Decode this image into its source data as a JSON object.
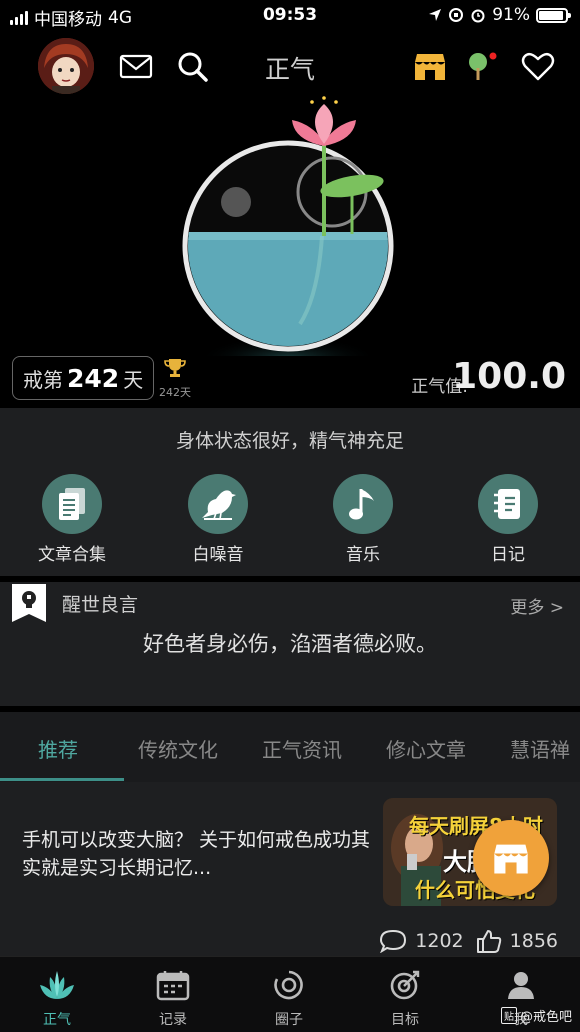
{
  "status_bar": {
    "carrier": "中国移动",
    "network": "4G",
    "time": "09:53",
    "battery": "91%",
    "battery_level": 0.91
  },
  "top_nav": {
    "title": "正气",
    "icons": [
      "mail-icon",
      "search-icon",
      "store-icon",
      "tree-icon",
      "heart-icon"
    ]
  },
  "hero": {
    "day_prefix": "戒第",
    "day_count": "242",
    "day_suffix": "天",
    "trophy_label": "242天",
    "qi_label": "正气值:",
    "qi_value": "100.0"
  },
  "panel": {
    "status_text": "身体状态很好，精气神充足",
    "features": [
      {
        "label": "文章合集",
        "icon": "documents-icon"
      },
      {
        "label": "白噪音",
        "icon": "bird-icon"
      },
      {
        "label": "音乐",
        "icon": "music-note-icon"
      },
      {
        "label": "日记",
        "icon": "diary-icon"
      }
    ]
  },
  "quote": {
    "title": "醒世良言",
    "more": "更多 >",
    "text": "好色者身必伤，淊酒者德必败。"
  },
  "tabs": [
    "推荐",
    "传统文化",
    "正气资讯",
    "修心文章",
    "慧语禅"
  ],
  "article": {
    "title": "手机可以改变大脑？ 关于如何戒色成功其实就是实习长期记忆...",
    "thumb_lines": [
      "每天刷屏8小时",
      "大脑",
      "什么可怕变化"
    ],
    "comments": "1202",
    "likes": "1856"
  },
  "bottom_nav": [
    {
      "label": "正气",
      "icon": "lotus-icon"
    },
    {
      "label": "记录",
      "icon": "calendar-icon"
    },
    {
      "label": "圈子",
      "icon": "circle-icon"
    },
    {
      "label": "目标",
      "icon": "target-icon"
    },
    {
      "label": "我",
      "icon": "user-icon"
    }
  ],
  "watermark": {
    "box": "贴",
    "text": "@戒色吧"
  },
  "colors": {
    "accent": "#4fa8a0",
    "water": "#5ea9b8",
    "panel": "#1e1f21",
    "fab": "#f0a23a"
  }
}
